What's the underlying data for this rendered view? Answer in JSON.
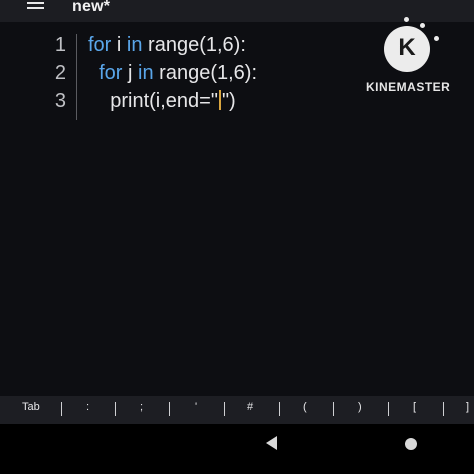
{
  "app": {
    "file_title": "new*"
  },
  "editor": {
    "lines": [
      {
        "num": "1",
        "indent": "",
        "kw1": "for",
        "mid": " i ",
        "kw2": "in",
        "rest": " range(1,6):"
      },
      {
        "num": "2",
        "indent": "  ",
        "kw1": "for",
        "mid": " j ",
        "kw2": "in",
        "rest": " range(1,6):"
      },
      {
        "num": "3",
        "indent": "    ",
        "text_before_caret": "print(i,end=\"",
        "text_after_caret": "\")"
      }
    ]
  },
  "watermark": {
    "logo_letter": "K",
    "brand": "KINEMASTER"
  },
  "keybar": {
    "keys": [
      "Tab",
      ":",
      ";",
      "'",
      "#",
      "(",
      ")",
      "[",
      "]"
    ]
  },
  "colors": {
    "keyword": "#5aa6ea",
    "text": "#e6e6e8",
    "caret": "#d9a640",
    "background": "#0d0e12"
  }
}
